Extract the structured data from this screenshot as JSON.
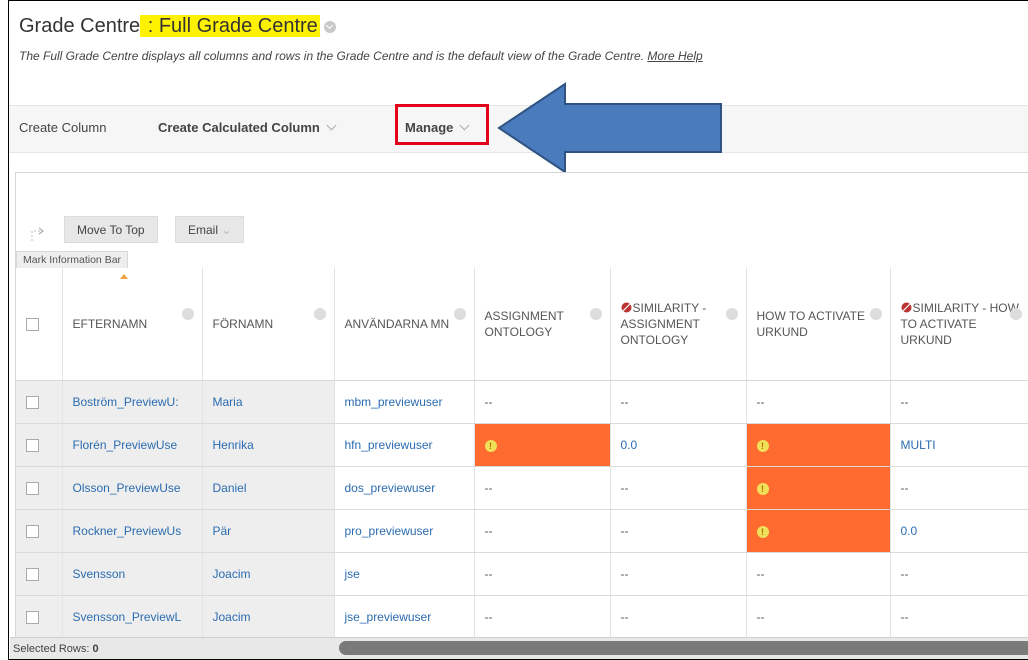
{
  "header": {
    "title_prefix": "Grade Centre",
    "title_sep": " : ",
    "title_highlight": "Full Grade Centre",
    "description": "The Full Grade Centre displays all columns and rows in the Grade Centre and is the default view of the Grade Centre.",
    "more_help": "More Help"
  },
  "toolbar": {
    "create_column": "Create Column",
    "create_calculated_column": "Create Calculated Column",
    "manage": "Manage"
  },
  "actions": {
    "move_to_top": "Move To Top",
    "email": "Email",
    "mark_information_bar": "Mark Information Bar"
  },
  "columns": [
    "EFTERNAMN",
    "FÖRNAMN",
    "ANVÄNDARNA MN",
    "ASSIGNMENT ONTOLOGY",
    "SIMILARITY - ASSIGNMENT ONTOLOGY",
    "HOW TO ACTIVATE URKUND",
    "SIMILARITY - HOW TO ACTIVATE URKUND"
  ],
  "rows": [
    [
      "Boström_PreviewU:",
      "Maria",
      "mbm_previewuser",
      "--",
      "--",
      "--",
      "--"
    ],
    [
      "Florén_PreviewUse",
      "Henrika",
      "hfn_previewuser",
      "!",
      "0.0",
      "!",
      "MULTI"
    ],
    [
      "Olsson_PreviewUse",
      "Daniel",
      "dos_previewuser",
      "--",
      "--",
      "!",
      "--"
    ],
    [
      "Rockner_PreviewUs",
      "Pär",
      "pro_previewuser",
      "--",
      "--",
      "!",
      "0.0"
    ],
    [
      "Svensson",
      "Joacim",
      "jse",
      "--",
      "--",
      "--",
      "--"
    ],
    [
      "Svensson_PreviewL",
      "Joacim",
      "jse_previewuser",
      "--",
      "--",
      "--",
      "--"
    ]
  ],
  "footer": {
    "selected_rows_label": "Selected Rows:",
    "selected_rows_count": "0"
  },
  "colors": {
    "highlight": "#fff200",
    "annotation_red": "#e3001b",
    "arrow_blue": "#4a7bbd",
    "needs_grading": "#ff6a2e",
    "link": "#2b6cb0"
  },
  "icons": [
    "chevron-down-icon",
    "arrow-left-icon",
    "needs-grading-icon",
    "not-visible-icon",
    "sort-asc-icon"
  ]
}
